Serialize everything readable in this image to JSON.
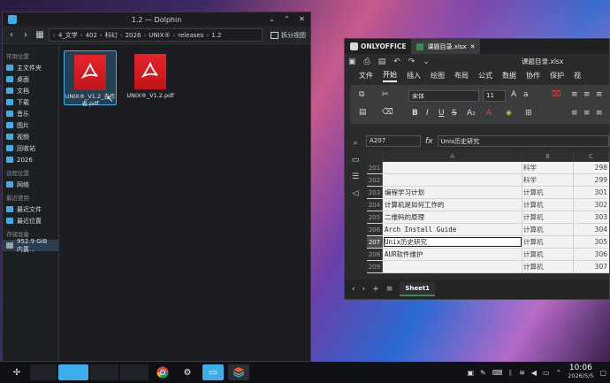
{
  "dolphin": {
    "title": "1.2 — Dolphin",
    "breadcrumb": [
      "4_文学",
      "402",
      "科幻",
      "2026",
      "UNIX®",
      "releases",
      "1.2"
    ],
    "split_label": "拆分视图",
    "sidebar": {
      "places_heading": "常用位置",
      "places": [
        "主文件夹",
        "桌面",
        "文档",
        "下载",
        "音乐",
        "图片",
        "视频",
        "回收站",
        "2026"
      ],
      "remote_heading": "远程位置",
      "remote": [
        "网络"
      ],
      "recent_heading": "最近使用",
      "recent": [
        "最近文件",
        "最近位置"
      ],
      "devices_heading": "存储设备",
      "devices": [
        "952.9 GiB 内置..."
      ]
    },
    "files": [
      {
        "name": "UNIX®_V1.2_去作者.pdf",
        "selected": true
      },
      {
        "name": "UNIX®_V1.2.pdf",
        "selected": false
      }
    ]
  },
  "onlyoffice": {
    "brand": "ONLYOFFICE",
    "tab_name": "课题目录.xlsx",
    "doc_title": "课题目录.xlsx",
    "menu": [
      "文件",
      "开始",
      "插入",
      "绘图",
      "布局",
      "公式",
      "数据",
      "协作",
      "保护",
      "视"
    ],
    "active_menu": "开始",
    "font_name": "宋体",
    "font_size": "11",
    "cell_ref": "A207",
    "formula": "Unix历史研究",
    "columns": [
      "A",
      "B",
      "C"
    ],
    "rows": [
      {
        "n": "201",
        "a": "",
        "b": "科学",
        "c": "298"
      },
      {
        "n": "202",
        "a": "",
        "b": "科学",
        "c": "299"
      },
      {
        "n": "203",
        "a": "编程学习计划",
        "b": "计算机",
        "c": "301"
      },
      {
        "n": "204",
        "a": "计算机是如何工作的",
        "b": "计算机",
        "c": "302"
      },
      {
        "n": "205",
        "a": "二维码的原理",
        "b": "计算机",
        "c": "303"
      },
      {
        "n": "206",
        "a": "Arch Install Guide",
        "b": "计算机",
        "c": "304"
      },
      {
        "n": "207",
        "a": "Unix历史研究",
        "b": "计算机",
        "c": "305"
      },
      {
        "n": "208",
        "a": "AUR软件维护",
        "b": "计算机",
        "c": "306"
      },
      {
        "n": "209",
        "a": "",
        "b": "计算机",
        "c": "307"
      }
    ],
    "selected_row": "207",
    "sheet": "Sheet1"
  },
  "taskbar": {
    "time": "10:06",
    "date": "2026/5/5"
  }
}
